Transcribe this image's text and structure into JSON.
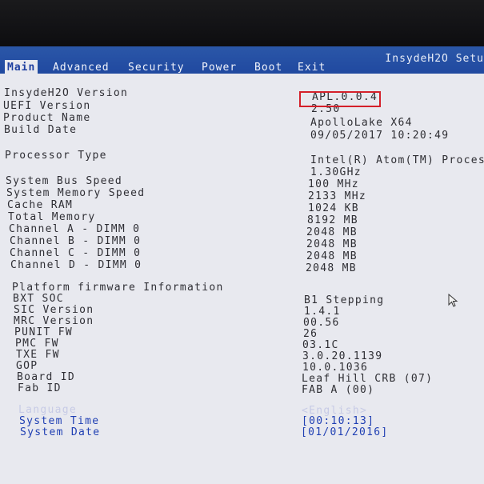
{
  "brand": "InsydeH2O Setu",
  "tabs": [
    {
      "label": "Main",
      "active": true
    },
    {
      "label": "Advanced"
    },
    {
      "label": "Security"
    },
    {
      "label": "Power"
    },
    {
      "label": "Boot"
    },
    {
      "label": "Exit"
    }
  ],
  "info": {
    "version_label": "InsydeH2O Version",
    "version_value": "APL.0.0.4",
    "uefi_label": "UEFI Version",
    "uefi_value": "2.50",
    "product_label": "Product Name",
    "product_value": "ApolloLake X64",
    "build_label": "Build Date",
    "build_value": "09/05/2017 10:20:49",
    "processor_label": "Processor Type",
    "processor_value": "Intel(R) Atom(TM) Process",
    "processor_freq": "1.30GHz",
    "bus_label": "System Bus Speed",
    "bus_value": "100 MHz",
    "memspeed_label": "System Memory Speed",
    "memspeed_value": "2133 MHz",
    "cache_label": "Cache RAM",
    "cache_value": "1024 KB",
    "totalmem_label": "Total Memory",
    "totalmem_value": "8192 MB",
    "dimms": [
      {
        "label": "Channel A - DIMM 0",
        "value": "2048 MB"
      },
      {
        "label": "Channel B - DIMM 0",
        "value": "2048 MB"
      },
      {
        "label": "Channel C - DIMM 0",
        "value": "2048 MB"
      },
      {
        "label": "Channel D - DIMM 0",
        "value": "2048 MB"
      }
    ]
  },
  "firmware": {
    "heading": "Platform firmware Information",
    "items": [
      {
        "label": "BXT SOC",
        "value": "B1 Stepping"
      },
      {
        "label": "SIC Version",
        "value": "1.4.1"
      },
      {
        "label": "MRC Version",
        "value": "00.56"
      },
      {
        "label": "PUNIT FW",
        "value": "26"
      },
      {
        "label": "PMC FW",
        "value": "03.1C"
      },
      {
        "label": "TXE FW",
        "value": "3.0.20.1139"
      },
      {
        "label": "GOP",
        "value": "10.0.1036"
      },
      {
        "label": "Board ID",
        "value": "Leaf Hill CRB (07)"
      },
      {
        "label": "Fab ID",
        "value": "FAB A (00)"
      }
    ]
  },
  "settings": {
    "language_label": "Language",
    "language_value": "<English>",
    "time_label": "System Time",
    "time_value": "[00:10:13]",
    "date_label": "System Date",
    "date_value": "[01/01/2016]"
  },
  "colors": {
    "topbar": "#2049a0",
    "background": "#e8e9ef",
    "highlight": "#d4202a",
    "setting_blue": "#1f3fb3"
  }
}
